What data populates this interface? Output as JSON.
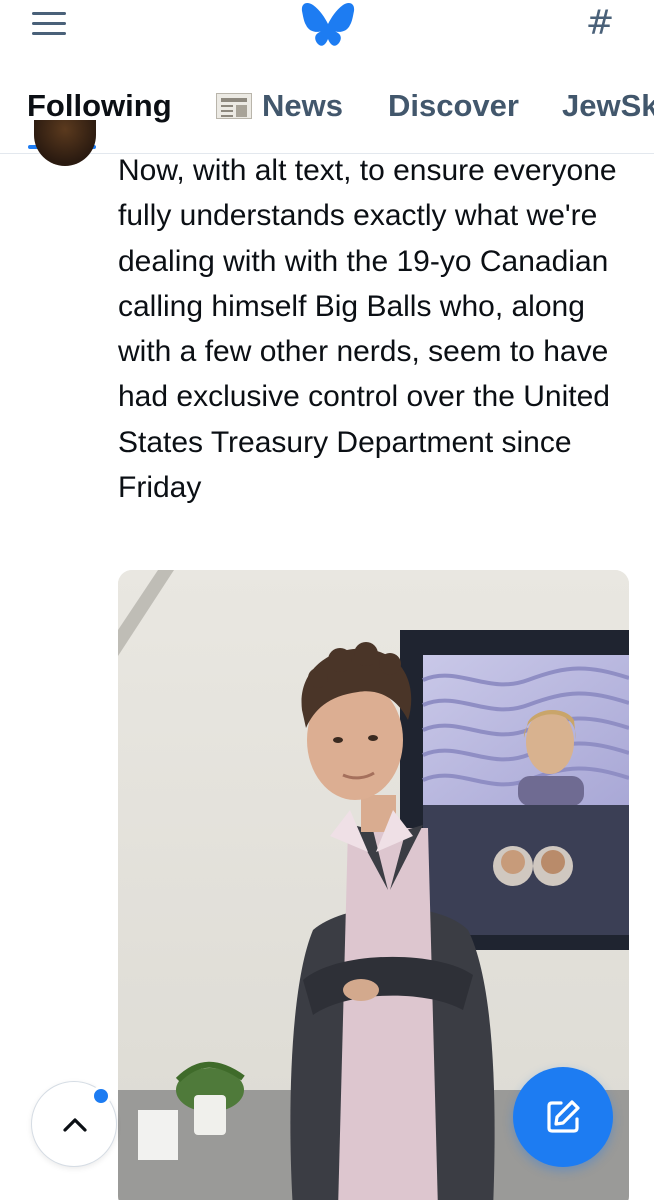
{
  "header": {
    "menu_icon": "hamburger-menu-icon",
    "logo_icon": "butterfly-logo-icon",
    "feeds_icon": "hash-icon",
    "feeds_glyph": "#",
    "brand_color": "#1d7cf2"
  },
  "tabs": [
    {
      "label": "Following",
      "active": true
    },
    {
      "label": "News",
      "icon": "newspaper-icon"
    },
    {
      "label": "Discover"
    },
    {
      "label": "JewSk"
    }
  ],
  "post": {
    "text": "Now, with alt text, to ensure everyone fully understands exactly what we're dealing with with the 19-yo Canadian calling himself Big Balls who, along with a few other nerds, seem to have had exclusive control over the United States Treasury Department since Friday"
  },
  "fabs": {
    "scroll_top_icon": "chevron-up-icon",
    "compose_icon": "compose-icon"
  }
}
